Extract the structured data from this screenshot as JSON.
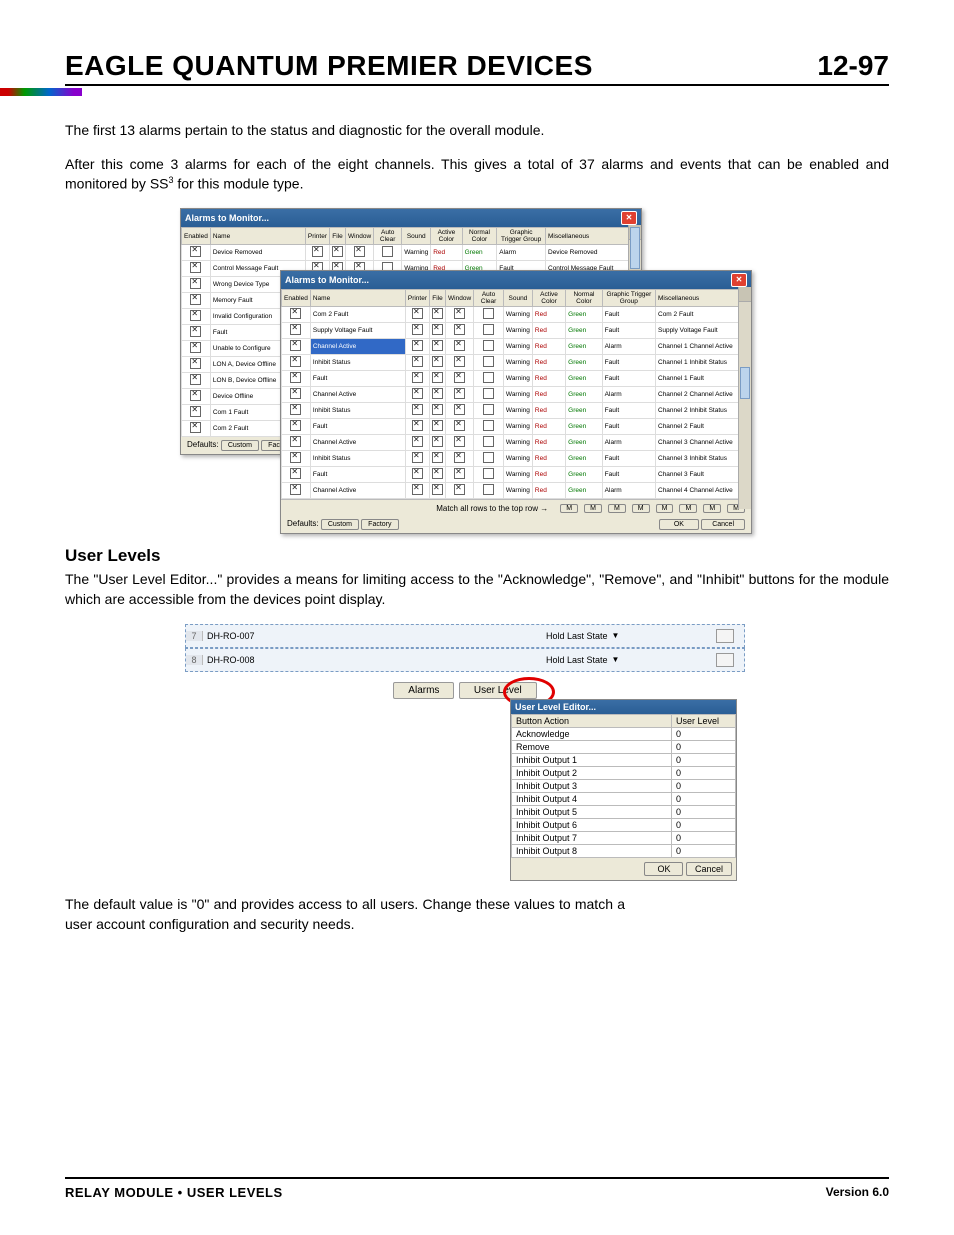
{
  "header": {
    "title": "EAGLE QUANTUM PREMIER DEVICES",
    "page": "12-97"
  },
  "p1": "The first 13 alarms pertain to the status and diagnostic for the overall module.",
  "p2_a": "After this come 3 alarms for each of the eight channels.  This gives a total of 37 alarms and events that can be enabled and monitored by S",
  "p2_sup": "3",
  "p2_b": " for this module type.",
  "dlg_title": "Alarms to Monitor...",
  "cols": {
    "enabled": "Enabled",
    "name": "Name",
    "printer": "Printer",
    "file": "File",
    "window": "Window",
    "autoclear": "Auto Clear",
    "sound": "Sound",
    "active": "Active Color",
    "normal": "Normal Color",
    "group": "Graphic Trigger Group",
    "misc": "Miscellaneous"
  },
  "snd": "Warning",
  "clrA": "Red",
  "clrN": "Green",
  "grpA": "Alarm",
  "grpF": "Fault",
  "rows1": [
    {
      "n": "Device Removed",
      "g": "Alarm",
      "m": "Device Removed"
    },
    {
      "n": "Control Message Fault",
      "g": "Fault",
      "m": "Control Message Fault"
    },
    {
      "n": "Wrong Device Type"
    },
    {
      "n": "Memory Fault"
    },
    {
      "n": "Invalid Configuration"
    },
    {
      "n": "Fault"
    },
    {
      "n": "Unable to Configure"
    },
    {
      "n": "LON A, Device Offline"
    },
    {
      "n": "LON B, Device Offline"
    },
    {
      "n": "Device Offline"
    },
    {
      "n": "Com 1 Fault"
    },
    {
      "n": "Com 2 Fault"
    }
  ],
  "rows2": [
    {
      "n": "Com 2 Fault",
      "g": "Fault",
      "m": "Com 2 Fault"
    },
    {
      "n": "Supply Voltage Fault",
      "g": "Fault",
      "m": "Supply Voltage Fault"
    },
    {
      "n": "Channel Active",
      "g": "Alarm",
      "m": "Channel 1 Channel Active",
      "hl": true
    },
    {
      "n": "Inhibit Status",
      "g": "Fault",
      "m": "Channel 1 Inhibit Status"
    },
    {
      "n": "Fault",
      "g": "Fault",
      "m": "Channel 1 Fault"
    },
    {
      "n": "Channel Active",
      "g": "Alarm",
      "m": "Channel 2 Channel Active"
    },
    {
      "n": "Inhibit Status",
      "g": "Fault",
      "m": "Channel 2 Inhibit Status"
    },
    {
      "n": "Fault",
      "g": "Fault",
      "m": "Channel 2 Fault"
    },
    {
      "n": "Channel Active",
      "g": "Alarm",
      "m": "Channel 3 Channel Active"
    },
    {
      "n": "Inhibit Status",
      "g": "Fault",
      "m": "Channel 3 Inhibit Status"
    },
    {
      "n": "Fault",
      "g": "Fault",
      "m": "Channel 3 Fault"
    },
    {
      "n": "Channel Active",
      "g": "Alarm",
      "m": "Channel 4 Channel Active"
    }
  ],
  "match_label": "Match all rows to the top row →",
  "m_btn": "M",
  "defaults": "Defaults:",
  "custom": "Custom",
  "factory": "Factory",
  "ok": "OK",
  "cancel": "Cancel",
  "sec_title": "User Levels",
  "p3": "The \"User Level Editor...\" provides a means for limiting access to the \"Acknowledge\", \"Remove\", and \"Inhibit\" buttons for the module which are accessible from the devices point display.",
  "grid": [
    {
      "i": "7",
      "n": "DH-RO-007",
      "s": "Hold Last State"
    },
    {
      "i": "8",
      "n": "DH-RO-008",
      "s": "Hold Last State"
    }
  ],
  "tab_alarms": "Alarms",
  "tab_userlevel": "User Level",
  "p4": "The default value is \"0\" and provides access to all users. Change these values to match a user account configuration and security needs.",
  "ule_title": "User Level Editor...",
  "ule_h1": "Button Action",
  "ule_h2": "User Level",
  "ule_rows": [
    {
      "a": "Acknowledge",
      "v": "0"
    },
    {
      "a": "Remove",
      "v": "0"
    },
    {
      "a": "Inhibit Output 1",
      "v": "0"
    },
    {
      "a": "Inhibit Output 2",
      "v": "0"
    },
    {
      "a": "Inhibit Output 3",
      "v": "0"
    },
    {
      "a": "Inhibit Output 4",
      "v": "0"
    },
    {
      "a": "Inhibit Output 5",
      "v": "0"
    },
    {
      "a": "Inhibit Output 6",
      "v": "0"
    },
    {
      "a": "Inhibit Output 7",
      "v": "0"
    },
    {
      "a": "Inhibit Output 8",
      "v": "0"
    }
  ],
  "footer": {
    "left": "RELAY MODULE • USER LEVELS",
    "right": "Version 6.0"
  }
}
